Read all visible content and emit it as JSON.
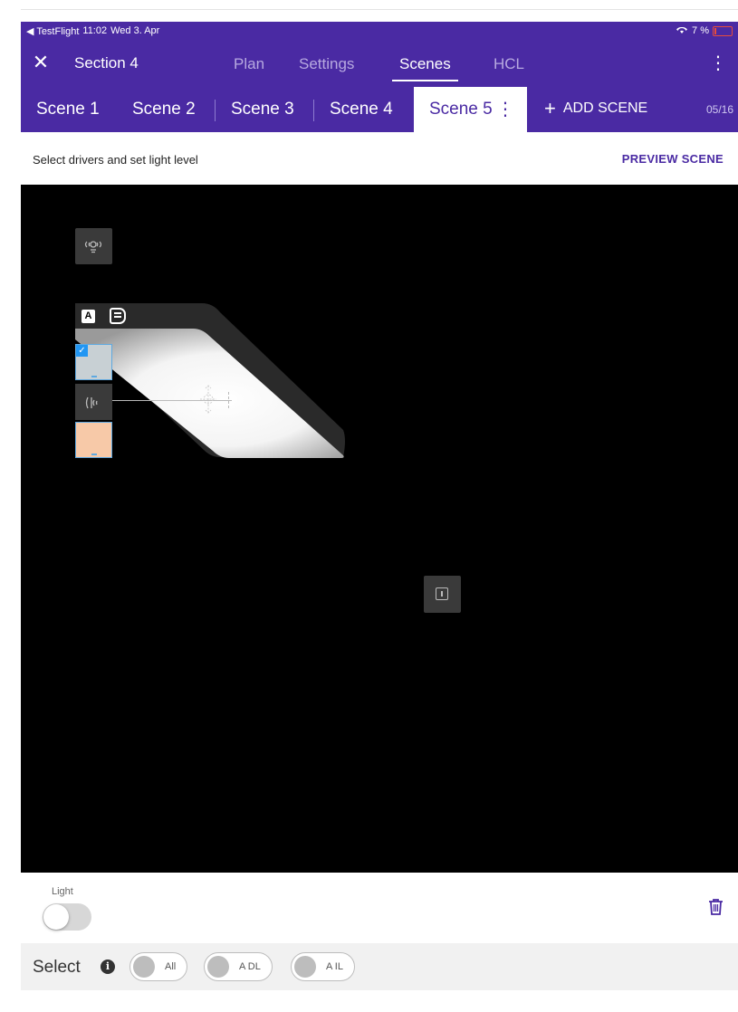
{
  "status_bar": {
    "back_app": "◀ TestFlight",
    "time": "11:02",
    "date": "Wed 3. Apr",
    "battery": "7 %"
  },
  "header": {
    "section_title": "Section 4",
    "nav_tabs": [
      {
        "label": "Plan",
        "active": false
      },
      {
        "label": "Settings",
        "active": false
      },
      {
        "label": "Scenes",
        "active": true
      },
      {
        "label": "HCL",
        "active": false
      }
    ]
  },
  "scenes": {
    "tabs": [
      {
        "label": "Scene 1",
        "active": false
      },
      {
        "label": "Scene 2",
        "active": false
      },
      {
        "label": "Scene 3",
        "active": false
      },
      {
        "label": "Scene 4",
        "active": false
      },
      {
        "label": "Scene 5",
        "active": true
      }
    ],
    "add_label": "ADD SCENE",
    "count": "05/16"
  },
  "subbar": {
    "instruction": "Select drivers and set light level",
    "preview_label": "PREVIEW SCENE"
  },
  "canvas": {
    "badge_a": "A"
  },
  "bottom": {
    "light_label": "Light",
    "light_on": false,
    "select_label": "Select",
    "chips": [
      {
        "label": "All"
      },
      {
        "label": "A DL"
      },
      {
        "label": "A IL"
      }
    ]
  },
  "colors": {
    "header_bg": "#4a2aa3",
    "accent": "#4a2aa3",
    "selection": "#2196f3"
  }
}
